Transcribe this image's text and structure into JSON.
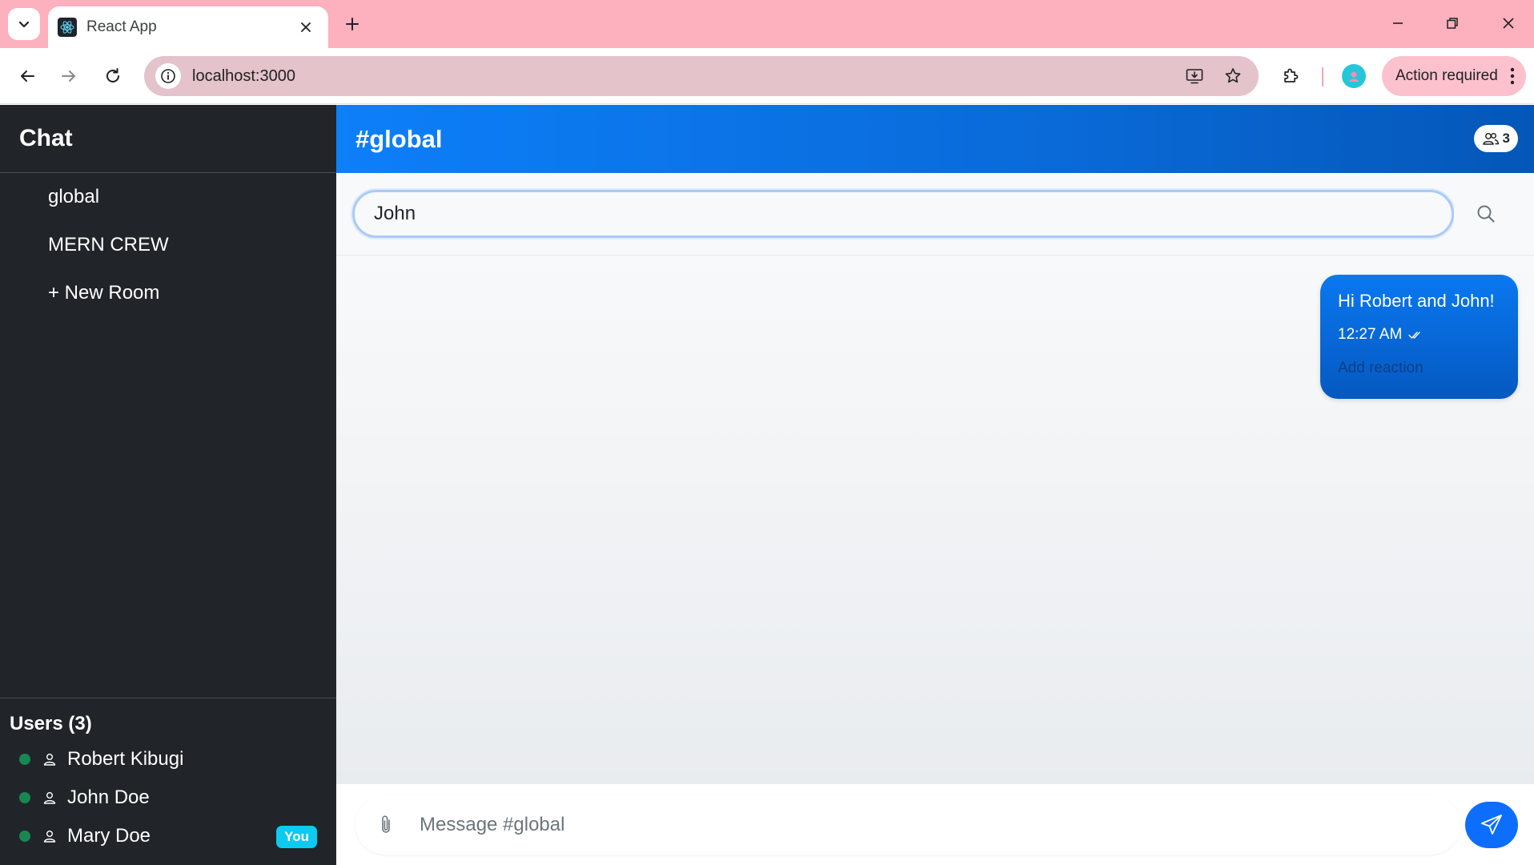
{
  "browser": {
    "tab_title": "React App",
    "url": "localhost:3000",
    "action_required_label": "Action required",
    "colors": {
      "tabbar": "#fdb0be",
      "omnibox": "#e4c3cb"
    }
  },
  "sidebar": {
    "title": "Chat",
    "rooms": [
      {
        "label": "global"
      },
      {
        "label": "MERN CREW"
      }
    ],
    "new_room_label": "+ New Room",
    "users_title": "Users (3)",
    "users": [
      {
        "name": "Robert Kibugi",
        "status": "online"
      },
      {
        "name": "John Doe",
        "status": "online"
      },
      {
        "name": "Mary Doe",
        "status": "online",
        "badge": "You"
      }
    ]
  },
  "chat": {
    "room_title": "#global",
    "member_count": "3",
    "search": {
      "value": "John"
    },
    "messages": [
      {
        "text": "Hi Robert and John!",
        "time": "12:27 AM",
        "reaction_label": "Add reaction"
      }
    ],
    "composer": {
      "placeholder": "Message #global"
    },
    "colors": {
      "accent": "#0d6efd",
      "sidebar": "#212529",
      "online": "#198754",
      "badge": "#0dcaf0"
    }
  }
}
